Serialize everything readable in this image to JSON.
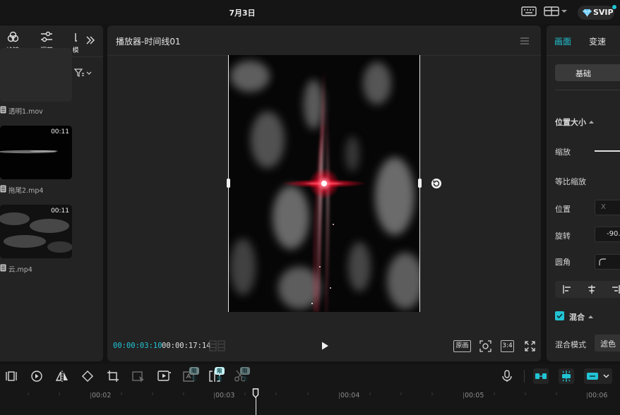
{
  "titlebar": {
    "date": "7月3日",
    "svip_label": "SVIP"
  },
  "left_panel": {
    "tools": [
      {
        "label": "滤镜",
        "icon": "filter-icon"
      },
      {
        "label": "调节",
        "icon": "adjust-icon"
      },
      {
        "label": "模",
        "icon": "template-icon"
      }
    ],
    "media": [
      {
        "name": "透明1.mov",
        "duration": ""
      },
      {
        "name": "拖尾2.mp4",
        "duration": "00:11"
      },
      {
        "name": "云.mp4",
        "duration": "00:11"
      }
    ]
  },
  "player": {
    "title": "播放器-时间线01",
    "current_time": "00:00:03:10",
    "total_time": "00:00:17:14",
    "original_label": "原画",
    "ratio_label": "3:4"
  },
  "inspector": {
    "tabs": [
      "画面",
      "变速"
    ],
    "subtab": "基础",
    "section_position": "位置大小",
    "scale_label": "缩放",
    "uniform_scale_label": "等比缩放",
    "position_label": "位置",
    "position_x_placeholder": "X",
    "rotation_label": "旋转",
    "rotation_value": "-90.",
    "corner_label": "圆角",
    "blend_section": "混合",
    "blend_mode_label": "混合模式",
    "blend_mode_value": "滤色"
  },
  "timeline": {
    "badges": [
      "限免",
      "限免",
      "限免"
    ],
    "ticks": [
      "00:02",
      "00:03",
      "00:04",
      "00:05",
      "00:06"
    ]
  },
  "colors": {
    "accent": "#22c4d4",
    "panel": "#232323",
    "background": "#131313"
  }
}
